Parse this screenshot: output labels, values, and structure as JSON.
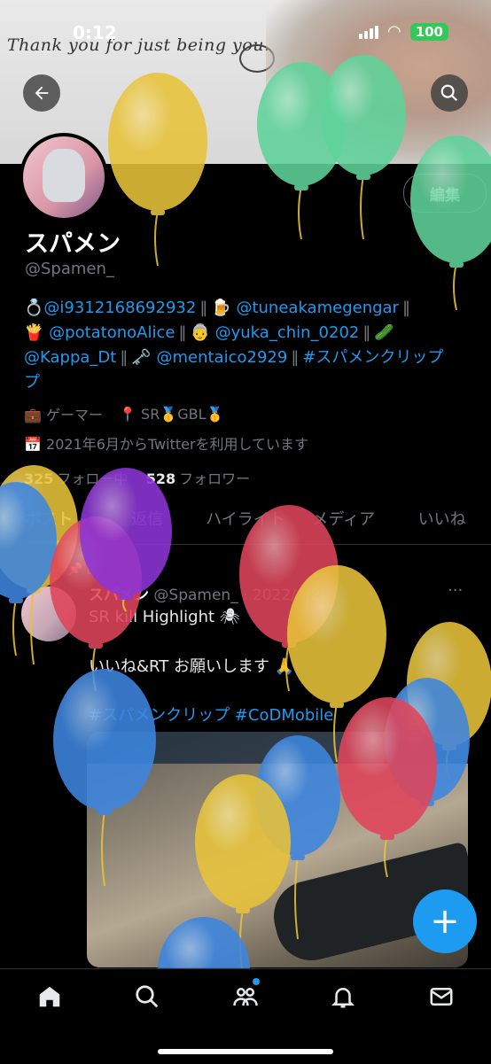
{
  "status_bar": {
    "time": "0:12",
    "battery": "100"
  },
  "banner": {
    "text": "Thank you for just being you."
  },
  "profile": {
    "edit_label": "編集",
    "display_name": "スパメン",
    "handle": "@Spamen_",
    "bio": {
      "line1": [
        {
          "emoji": "💍",
          "text": "@i9312168692932"
        },
        {
          "emoji": "🍺",
          "text": "@tuneakamegengar"
        }
      ],
      "line2": [
        {
          "emoji": "🍟",
          "text": "@potatonoAlice"
        },
        {
          "emoji": "👵",
          "text": "@yuka_chin_0202"
        },
        {
          "emoji": "🥒",
          "text": ""
        }
      ],
      "line3": [
        {
          "emoji": "",
          "text": "@Kappa_Dt"
        },
        {
          "emoji": "🗝️",
          "text": "@mentaico2929"
        },
        {
          "emoji": "",
          "text": "#スパメンクリップ"
        }
      ],
      "line4": "プ",
      "separator": "‖"
    },
    "job": "ゲーマー",
    "location": "SR🥇GBL🥇",
    "joined": "2021年6月からTwitterを利用しています",
    "following_count": "325",
    "following_label": "フォロー中",
    "followers_count": "528",
    "followers_label": "フォロワー"
  },
  "tabs": [
    {
      "label": "ポスト"
    },
    {
      "label": "返信"
    },
    {
      "label": "ハイライト"
    },
    {
      "label": "メディア"
    },
    {
      "label": "いいね"
    }
  ],
  "tweet": {
    "pinned_label": "固",
    "name": "スパメン",
    "handle": "@Spamen_ · 2022/4/26",
    "line1": "SR kill Highlight 🕷",
    "line2": "いいね&RT お願いします 🙏",
    "tags": "#スパメンクリップ #CoDMobile",
    "more": "···"
  },
  "icons": {
    "back": "back-arrow-icon",
    "search": "search-icon",
    "fab": "compose-plus-icon",
    "nav": [
      "home-icon",
      "search-icon",
      "communities-icon",
      "notifications-icon",
      "messages-icon"
    ]
  },
  "colors": {
    "accent": "#1d9bf0",
    "balloon_yellow": "#e8c33a",
    "balloon_green": "#5fd39a",
    "balloon_red": "#e0455a",
    "balloon_purple": "#8e35d6",
    "balloon_blue": "#3d86e0"
  }
}
